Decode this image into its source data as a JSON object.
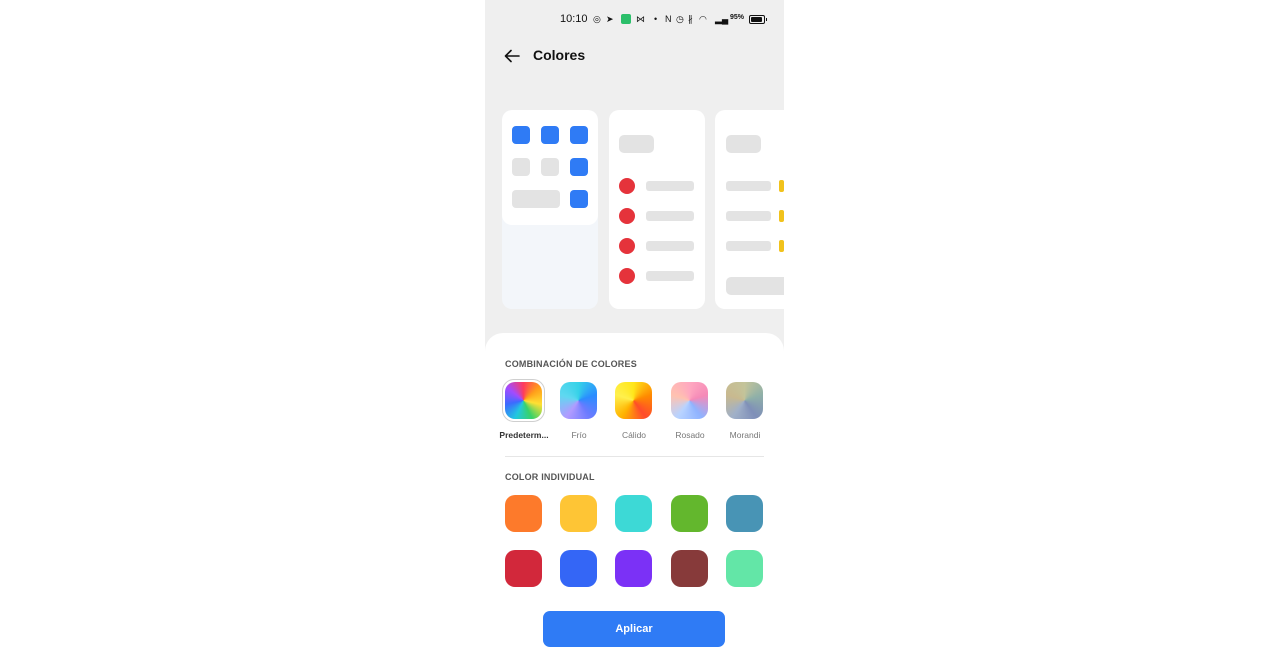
{
  "status_bar": {
    "time": "10:10",
    "icons": [
      "whatsapp-icon",
      "telegram-icon",
      "app-icon",
      "mail-icon",
      "dot-icon",
      "nfc-icon",
      "alarm-icon",
      "bluetooth-icon",
      "wifi-icon",
      "signal-icon"
    ],
    "battery_text": "95%",
    "battery_level": 0.95
  },
  "header": {
    "title": "Colores"
  },
  "preview_colors": {
    "accent": "#2f7bf5",
    "red": "#e5333b",
    "yellow": "#f1c21b"
  },
  "combinations": {
    "title": "COMBINACIÓN DE COLORES",
    "items": [
      {
        "label": "Predeterm...",
        "selected": true
      },
      {
        "label": "Frío",
        "selected": false
      },
      {
        "label": "Cálido",
        "selected": false
      },
      {
        "label": "Rosado",
        "selected": false
      },
      {
        "label": "Morandi",
        "selected": false
      }
    ]
  },
  "individual": {
    "title": "COLOR INDIVIDUAL",
    "colors": [
      "#fd7a2b",
      "#fec535",
      "#3dd9d6",
      "#63b72d",
      "#4894b5",
      "#d2283b",
      "#3466f6",
      "#7b31f6",
      "#873a3a",
      "#63e6a7"
    ]
  },
  "apply_label": "Aplicar"
}
